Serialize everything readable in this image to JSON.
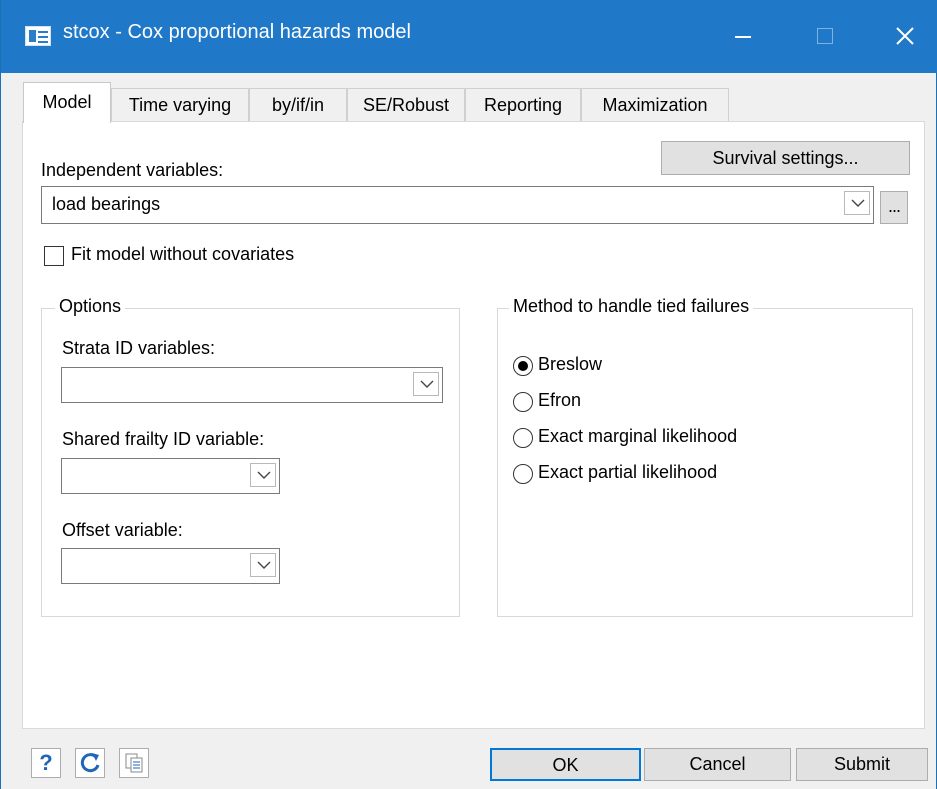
{
  "window": {
    "title": "stcox - Cox proportional hazards model"
  },
  "tabs": [
    {
      "label": "Model",
      "active": true
    },
    {
      "label": "Time varying",
      "active": false
    },
    {
      "label": "by/if/in",
      "active": false
    },
    {
      "label": "SE/Robust",
      "active": false
    },
    {
      "label": "Reporting",
      "active": false
    },
    {
      "label": "Maximization",
      "active": false
    }
  ],
  "model": {
    "survival_settings_label": "Survival settings...",
    "independent_label": "Independent variables:",
    "independent_value": "load bearings",
    "ellipsis_label": "...",
    "no_covariates_label": "Fit model without covariates",
    "no_covariates_checked": false
  },
  "options": {
    "title": "Options",
    "strata_label": "Strata ID variables:",
    "strata_value": "",
    "frailty_label": "Shared frailty ID variable:",
    "frailty_value": "",
    "offset_label": "Offset variable:",
    "offset_value": ""
  },
  "ties": {
    "title": "Method to handle tied failures",
    "options": [
      {
        "label": "Breslow",
        "checked": true
      },
      {
        "label": "Efron",
        "checked": false
      },
      {
        "label": "Exact marginal likelihood",
        "checked": false
      },
      {
        "label": "Exact partial likelihood",
        "checked": false
      }
    ]
  },
  "footer": {
    "help_label": "?",
    "ok_label": "OK",
    "cancel_label": "Cancel",
    "submit_label": "Submit"
  },
  "colors": {
    "titlebar": "#1f78c8",
    "ok_border": "#0078d7"
  }
}
